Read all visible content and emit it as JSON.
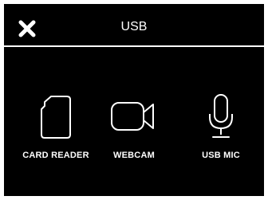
{
  "header": {
    "title": "USB",
    "close_icon": "close-icon"
  },
  "options": [
    {
      "label": "CARD READER",
      "icon": "sd-card-icon"
    },
    {
      "label": "WEBCAM",
      "icon": "video-camera-icon"
    },
    {
      "label": "USB MIC",
      "icon": "microphone-icon"
    }
  ],
  "colors": {
    "background": "#000000",
    "foreground": "#ffffff"
  }
}
